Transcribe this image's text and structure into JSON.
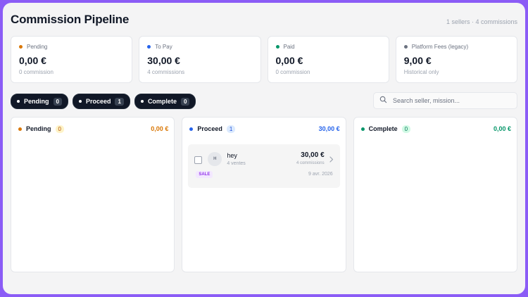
{
  "header": {
    "title": "Commission Pipeline",
    "meta": "1 sellers · 4 commissions"
  },
  "stats": [
    {
      "label": "Pending",
      "value": "0,00 €",
      "sub": "0 commission",
      "color": "#d97706"
    },
    {
      "label": "To Pay",
      "value": "30,00 €",
      "sub": "4 commissions",
      "color": "#2563eb"
    },
    {
      "label": "Paid",
      "value": "0,00 €",
      "sub": "0 commission",
      "color": "#059669"
    },
    {
      "label": "Platform Fees (legacy)",
      "value": "9,00 €",
      "sub": "Historical only",
      "color": "#6b7280"
    }
  ],
  "filters": [
    {
      "label": "Pending",
      "count": "0"
    },
    {
      "label": "Proceed",
      "count": "1"
    },
    {
      "label": "Complete",
      "count": "0"
    }
  ],
  "search": {
    "placeholder": "Search seller, mission..."
  },
  "columns": [
    {
      "title": "Pending",
      "count": "0",
      "total": "0,00 €",
      "color": "#d97706",
      "count_bg": "#fef3c7",
      "count_fg": "#b45309"
    },
    {
      "title": "Proceed",
      "count": "1",
      "total": "30,00 €",
      "color": "#2563eb",
      "count_bg": "#dbeafe",
      "count_fg": "#1d4ed8"
    },
    {
      "title": "Complete",
      "count": "0",
      "total": "0,00 €",
      "color": "#059669",
      "count_bg": "#d1fae5",
      "count_fg": "#047857"
    }
  ],
  "card": {
    "avatar": "H",
    "name": "hey",
    "sales": "4 ventes",
    "amount": "30,00 €",
    "commissions": "4 commissions",
    "tag": "SALE",
    "date": "9 avr. 2026"
  },
  "icons": {
    "search": "search-icon",
    "chevron": "chevron-right-icon"
  }
}
